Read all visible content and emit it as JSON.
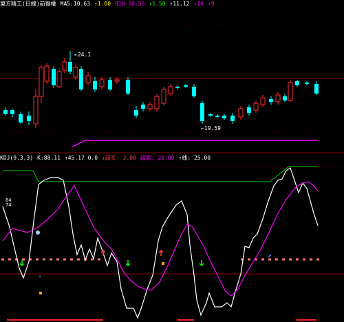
{
  "top_panel": {
    "header": [
      {
        "text": "東方精工(日線)前復權",
        "color": "#ffffff"
      },
      {
        "text": "MA5:10.63",
        "color": "#ffffff"
      },
      {
        "text": "↑1.00",
        "color": "#ffff00"
      },
      {
        "text": "910 10.55",
        "color": "#ff00ff"
      },
      {
        "text": "↑1.50",
        "color": "#00ff00"
      },
      {
        "text": "↑11.12",
        "color": "#ffffff"
      },
      {
        "text": "↑10",
        "color": "#ff00ff"
      },
      {
        "text": "↑9",
        "color": "#ff00ff"
      }
    ],
    "price_high_label": "←24.1",
    "price_low_label": "←19.59",
    "colors": {
      "up": "#ff3030",
      "down": "#00ffff",
      "ma": "#ff00ff",
      "grid": "#8b0000"
    }
  },
  "bottom_panel": {
    "header": [
      {
        "text": "KDJ(9,3,3)",
        "color": "#ffffff"
      },
      {
        "text": "K:88.11",
        "color": "#ffffff"
      },
      {
        "text": "↑45.17 0.0",
        "color": "#ffffff"
      },
      {
        "text": "↓超买: 3.00",
        "color": "#ff4040"
      },
      {
        "text": "超卖: 20.00",
        "color": "#ff00ff"
      },
      {
        "text": "↑线: 25.00",
        "color": "#ffffff"
      }
    ],
    "axis_labels": [
      "84",
      "74"
    ],
    "colors": {
      "k_line": "#ffffff",
      "d_line": "#ff00ff",
      "ceiling": "#00cc00",
      "dashed": "#ff6464"
    }
  }
}
